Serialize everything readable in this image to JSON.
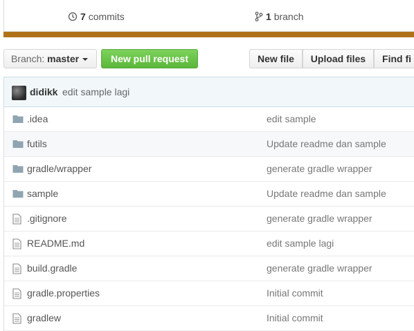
{
  "summary": {
    "commits_count": "7",
    "commits_label": "commits",
    "branch_count": "1",
    "branch_label": "branch"
  },
  "colors": {
    "language_bar": "#b07219",
    "pr_button": "#6cc644"
  },
  "toolbar": {
    "branch_label": "Branch:",
    "branch_name": "master",
    "new_pr_label": "New pull request",
    "new_file_label": "New file",
    "upload_files_label": "Upload files",
    "find_file_label": "Find fi"
  },
  "latest_commit": {
    "author": "didikk",
    "message": "edit sample lagi"
  },
  "files": [
    {
      "name": ".idea",
      "type": "folder",
      "message": "edit sample"
    },
    {
      "name": "futils",
      "type": "folder",
      "message": "Update readme dan sample"
    },
    {
      "name": "gradle/wrapper",
      "type": "folder",
      "message": "generate gradle wrapper"
    },
    {
      "name": "sample",
      "type": "folder",
      "message": "Update readme dan sample"
    },
    {
      "name": ".gitignore",
      "type": "file",
      "message": "generate gradle wrapper"
    },
    {
      "name": "README.md",
      "type": "file",
      "message": "edit sample lagi"
    },
    {
      "name": "build.gradle",
      "type": "file",
      "message": "generate gradle wrapper"
    },
    {
      "name": "gradle.properties",
      "type": "file",
      "message": "Initial commit"
    },
    {
      "name": "gradlew",
      "type": "file",
      "message": "Initial commit"
    }
  ]
}
